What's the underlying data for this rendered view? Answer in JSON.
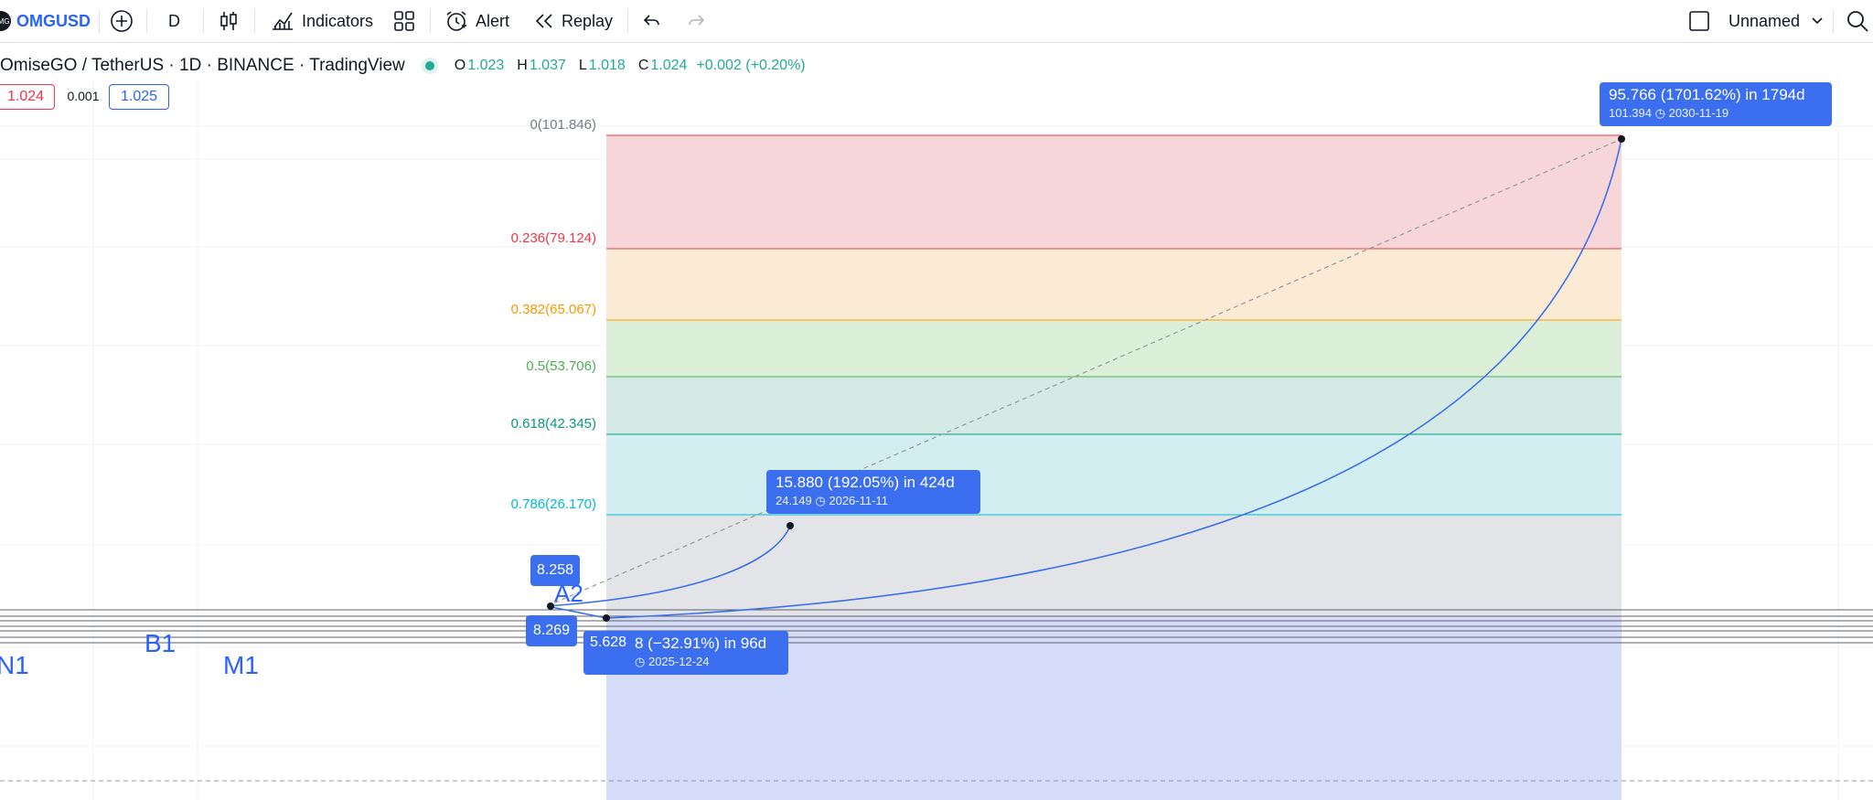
{
  "toolbar": {
    "logo_text": "OMG",
    "symbol": "OMGUSD",
    "interval": "D",
    "indicators": "Indicators",
    "alert": "Alert",
    "replay": "Replay",
    "layout_name": "Unnamed"
  },
  "legend": {
    "title": "OmiseGO / TetherUS · 1D · BINANCE · TradingView",
    "o_key": "O",
    "o_val": "1.023",
    "h_key": "H",
    "h_val": "1.037",
    "l_key": "L",
    "l_val": "1.018",
    "c_key": "C",
    "c_val": "1.024",
    "change": "+0.002 (+0.20%)",
    "bid": "1.024",
    "spread": "0.001",
    "ask": "1.025"
  },
  "fib_levels": [
    {
      "label": "0(101.846)",
      "color": "#787b86"
    },
    {
      "label": "0.236(79.124)",
      "color": "#f23645"
    },
    {
      "label": "0.382(65.067)",
      "color": "#ff9800"
    },
    {
      "label": "0.5(53.706)",
      "color": "#4caf50"
    },
    {
      "label": "0.618(42.345)",
      "color": "#089981"
    },
    {
      "label": "0.786(26.170)",
      "color": "#00bcd4"
    }
  ],
  "measures": {
    "top": {
      "main": "95.766 (1701.62%) in 1794d",
      "price": "101.394",
      "date": "2030-11-19"
    },
    "mid": {
      "main": "15.880 (192.05%) in 424d",
      "price": "24.149",
      "date": "2026-11-11"
    },
    "low": {
      "main": "8 (−32.91%) in 96d",
      "date": "2025-12-24"
    }
  },
  "points": {
    "p1": "8.258",
    "p2": "8.269",
    "p3": "5.628"
  },
  "wave_labels": {
    "n1": "N1",
    "b1": "B1",
    "m1": "M1",
    "a2": "A2"
  },
  "colors": {
    "accent": "#2962ff",
    "bubble": "#3b6ff0",
    "up": "#22ab94",
    "down": "#f23645"
  }
}
